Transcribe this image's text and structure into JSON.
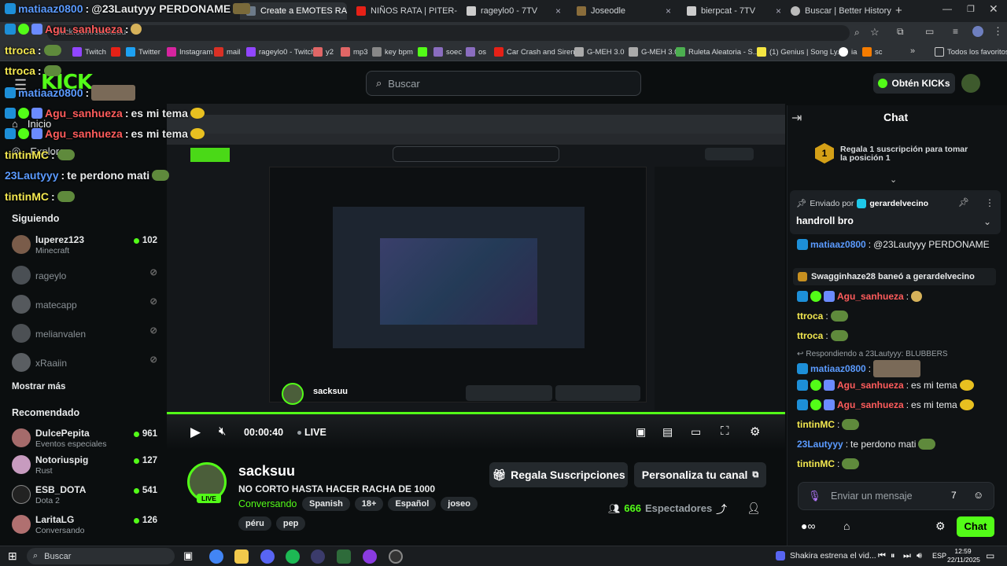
{
  "browser": {
    "tabs": [
      {
        "label": "Create a EMOTES RAGEYLO",
        "active": true
      },
      {
        "label": "NIÑOS RATA | PITER-G",
        "active": false
      },
      {
        "label": "rageylo0 - 7TV",
        "active": false
      },
      {
        "label": "Joseodle",
        "active": false
      },
      {
        "label": "bierpcat - 7TV",
        "active": false
      },
      {
        "label": "Buscar | Better History",
        "active": false
      }
    ],
    "url": "kick.com/sacksuu",
    "bookmarks": [
      "Twitch",
      "Twitter",
      "Instagram",
      "mail",
      "rageylo0 - Twitch",
      "y2",
      "mp3",
      "key bpm",
      "soec",
      "os",
      "Car Crash and Siren...",
      "G-MEH 3.0",
      "G-MEH 3.0",
      "Ruleta Aleatoria - S...",
      "(1) Genius | Song Ly...",
      "ia",
      "sc",
      "Todos los favoritos"
    ]
  },
  "header": {
    "search_placeholder": "Buscar",
    "obten_label": "Obtén KICKs"
  },
  "sidebar": {
    "nav": [
      {
        "label": "Inicio"
      },
      {
        "label": "Explorar"
      }
    ],
    "following_title": "Siguiendo",
    "following": [
      {
        "name": "luperez123",
        "sub": "Minecraft",
        "viewers": "102",
        "live": true
      },
      {
        "name": "rageylo",
        "live": false
      },
      {
        "name": "matecapp",
        "live": false
      },
      {
        "name": "melianvalen",
        "live": false
      },
      {
        "name": "xRaaiin",
        "live": false
      }
    ],
    "show_more": "Mostrar más",
    "recommended_title": "Recomendado",
    "recommended": [
      {
        "name": "DulcePepita",
        "sub": "Eventos especiales",
        "viewers": "961"
      },
      {
        "name": "Notoriuspig",
        "sub": "Rust",
        "viewers": "127"
      },
      {
        "name": "ESB_DOTA",
        "sub": "Dota 2",
        "viewers": "541"
      },
      {
        "name": "LaritaLG",
        "sub": "Conversando",
        "viewers": "126"
      }
    ]
  },
  "player": {
    "time": "00:00:40",
    "live_label": "LIVE",
    "progress": 1.0
  },
  "stream": {
    "name": "sacksuu",
    "live_label": "LIVE",
    "title": "NO CORTO HASTA HACER RACHA DE 1000",
    "category": "Conversando",
    "tags": [
      "Spanish",
      "18+",
      "Español",
      "joseo"
    ],
    "tags2": [
      "péru",
      "pep"
    ],
    "gift_label": "Regala Suscripciones",
    "custom_label": "Personaliza tu canal",
    "viewers": "666",
    "viewers_label": "Espectadores"
  },
  "chat": {
    "title": "Chat",
    "gift_goal": "Regala 1 suscripción para tomar la posición 1",
    "gift_rank": "1",
    "pinned_by_label": "Enviado por",
    "pinned_by": "gerardelvecino",
    "pinned_text": "handroll bro",
    "messages": [
      {
        "user": "matiaaz0800",
        "text": "@23Lautyyy PERDONAME",
        "color": "#5b9bff"
      },
      {
        "system": "Swagginhaze28 baneó a gerardelvecino"
      },
      {
        "user": "Agu_sanhueza",
        "text": "",
        "color": "#ff5c5c"
      },
      {
        "user": "ttroca",
        "text": "",
        "color": "#f3e850"
      },
      {
        "user": "ttroca",
        "text": "",
        "color": "#f3e850"
      },
      {
        "reply": "Respondiendo a 23Lautyyy: BLUBBERS"
      },
      {
        "user": "matiaaz0800",
        "text": "",
        "color": "#5b9bff"
      },
      {
        "user": "Agu_sanhueza",
        "text": "es mi tema",
        "color": "#ff5c5c"
      },
      {
        "user": "Agu_sanhueza",
        "text": "es mi tema",
        "color": "#ff5c5c"
      },
      {
        "user": "tintinMC",
        "text": "",
        "color": "#f3e850"
      },
      {
        "user": "23Lautyyy",
        "text": "te perdono mati",
        "color": "#5b9bff"
      },
      {
        "user": "tintinMC",
        "text": "",
        "color": "#f3e850"
      }
    ],
    "input_placeholder": "Enviar un mensaje",
    "send_label": "Chat"
  },
  "overlay": [
    {
      "user": "matiaaz0800",
      "text": "@23Lautyyy PERDONAME",
      "color": "#5b9bff"
    },
    {
      "user": "Agu_sanhueza",
      "text": "",
      "color": "#ff5c5c"
    },
    {
      "user": "ttroca",
      "text": "",
      "color": "#f3e850"
    },
    {
      "user": "ttroca",
      "text": "",
      "color": "#f3e850"
    },
    {
      "user": "matiaaz0800",
      "text": "",
      "color": "#5b9bff"
    },
    {
      "user": "Agu_sanhueza",
      "text": "es mi tema",
      "color": "#ff5c5c"
    },
    {
      "user": "Agu_sanhueza",
      "text": "es mi tema",
      "color": "#ff5c5c"
    },
    {
      "user": "tintinMC",
      "text": "",
      "color": "#f3e850"
    },
    {
      "user": "23Lautyyy",
      "text": "te perdono mati",
      "color": "#5b9bff"
    },
    {
      "user": "tintinMC",
      "text": "",
      "color": "#f3e850"
    }
  ],
  "taskbar": {
    "search": "Buscar",
    "media": "Shakira estrena el vid...",
    "lang": "ESP",
    "time": "12:59",
    "date": "22/11/2025"
  },
  "colors": {
    "accent": "#53fc18",
    "bg": "#0b0e0f",
    "panel": "#24292d"
  }
}
